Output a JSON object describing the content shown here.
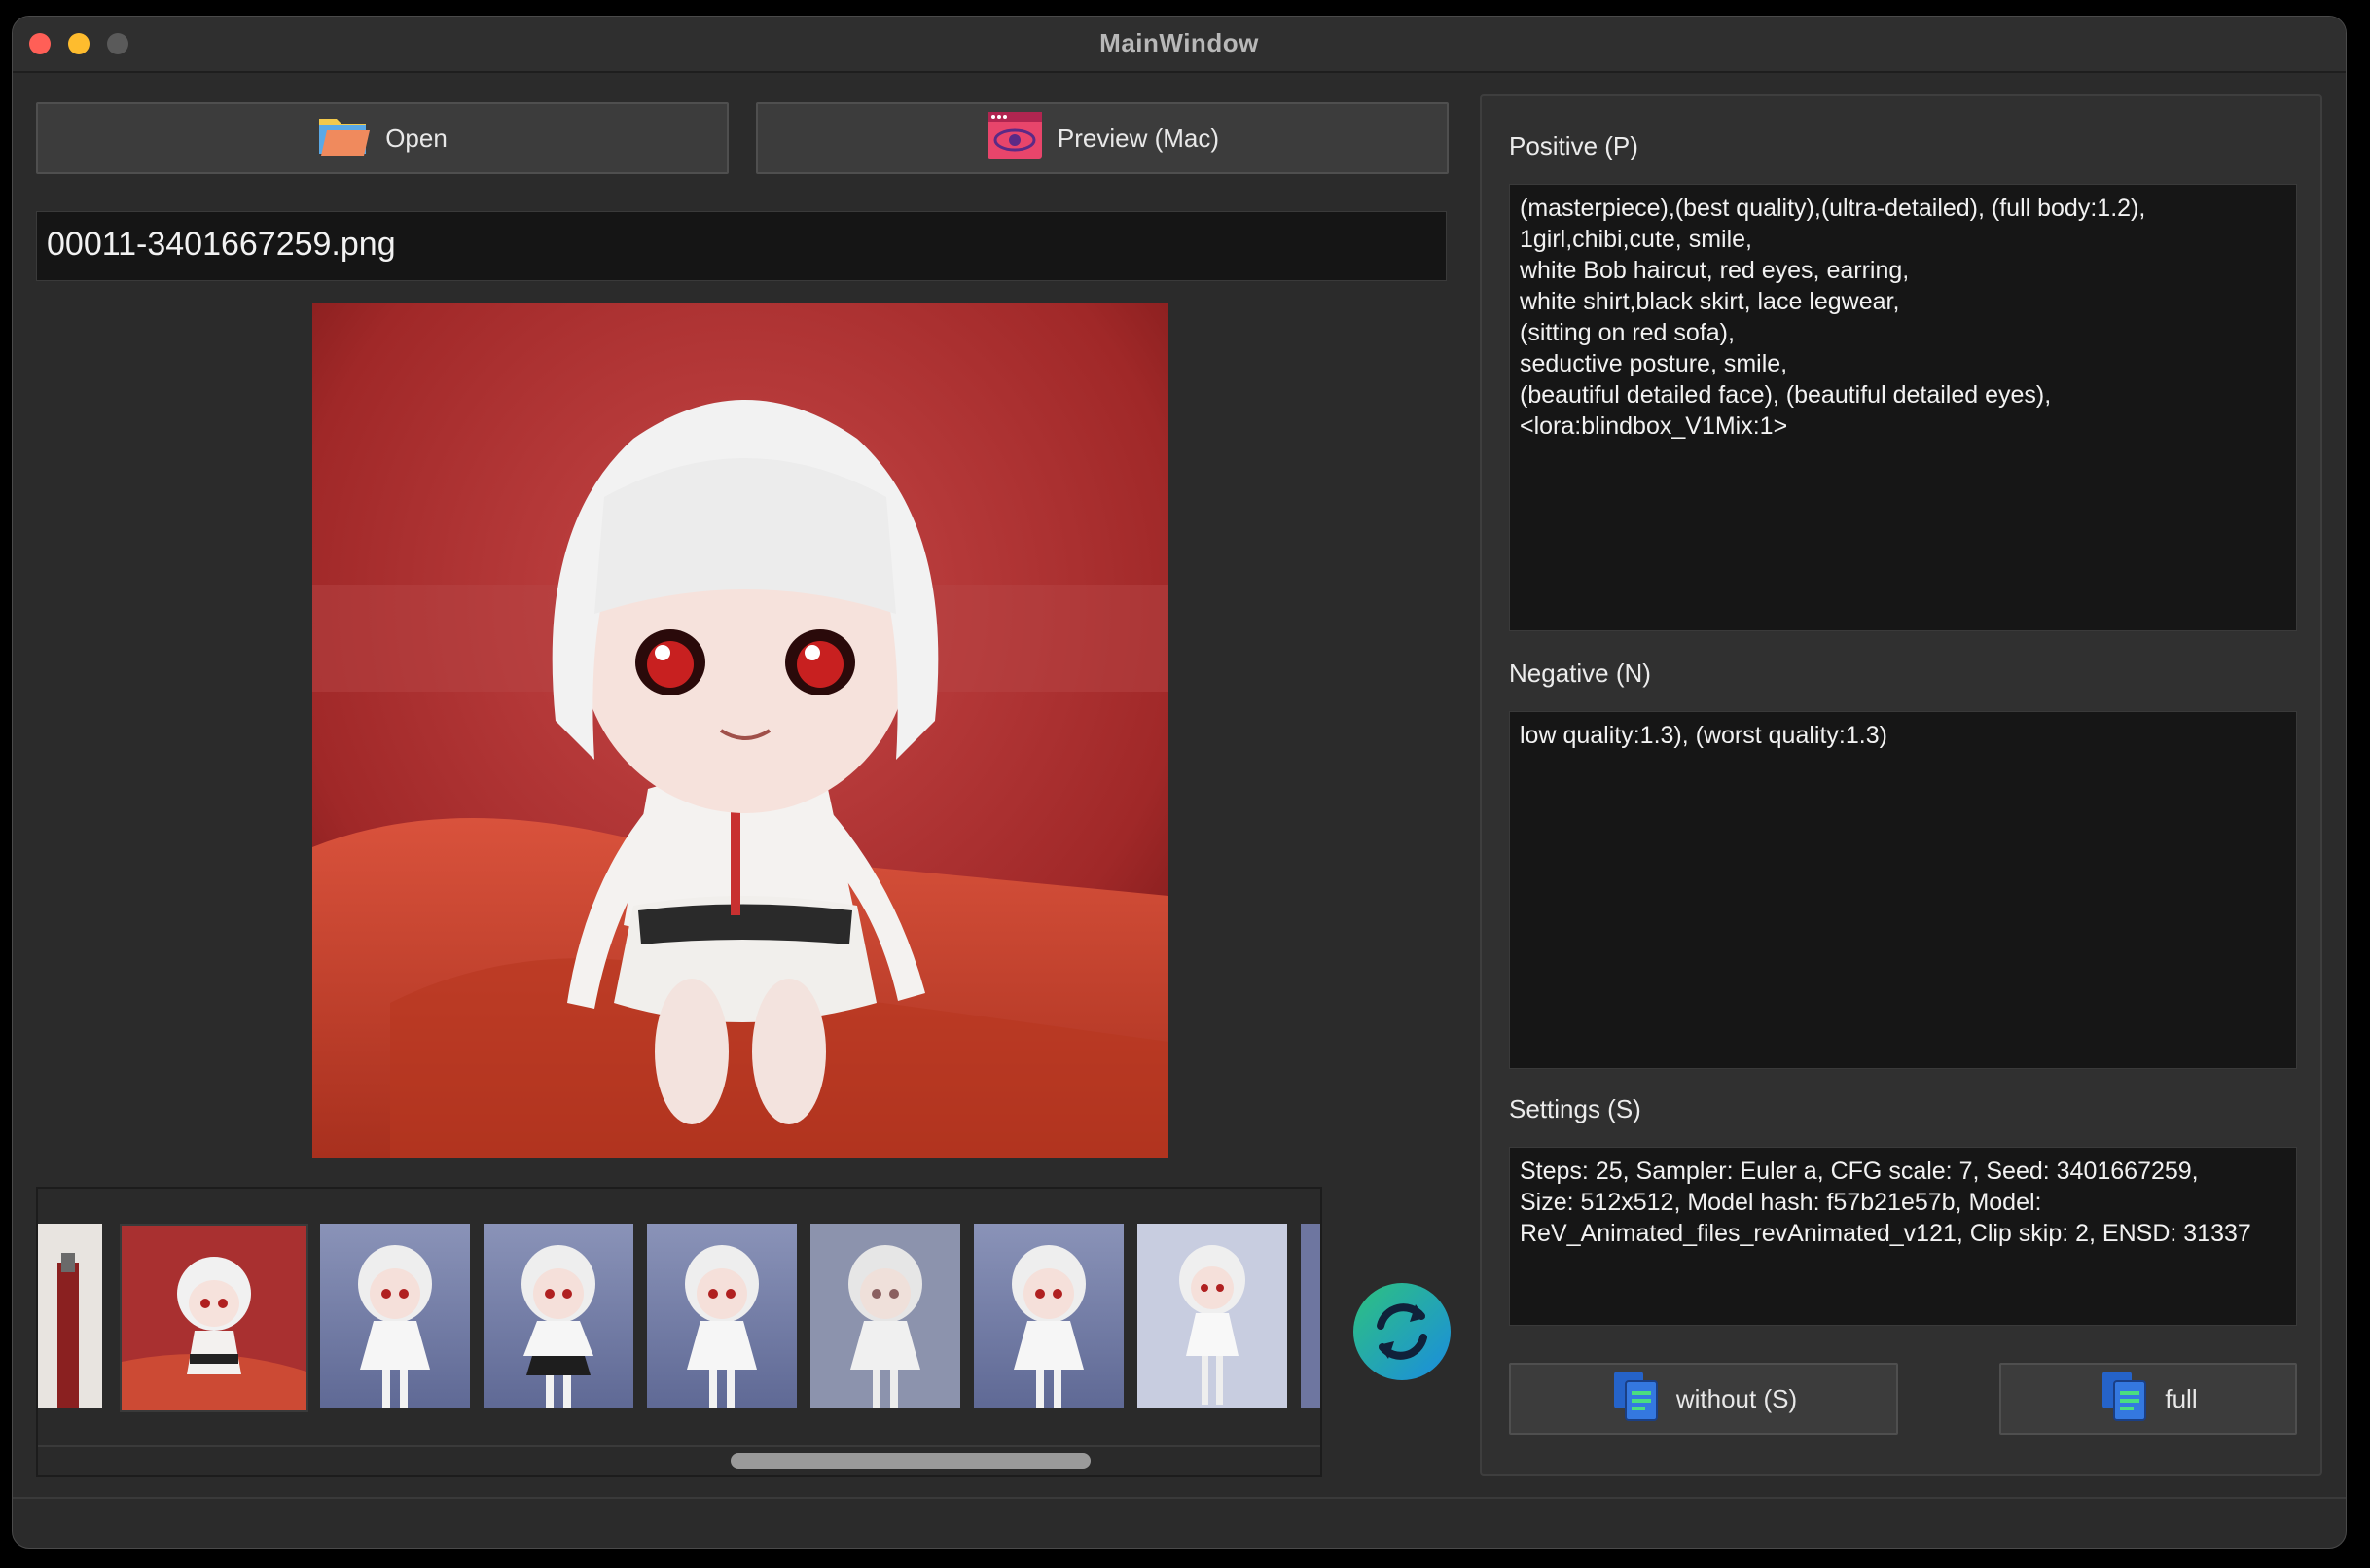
{
  "window": {
    "title": "MainWindow"
  },
  "toolbar": {
    "open_label": "Open",
    "preview_label": "Preview (Mac)",
    "open_icon": "folder-icon",
    "preview_icon": "preview-eye-icon"
  },
  "file": {
    "name": "00011-3401667259.png"
  },
  "thumbnails": {
    "count": 8
  },
  "prompts": {
    "positive_label": "Positive (P)",
    "positive_text": "(masterpiece),(best quality),(ultra-detailed), (full body:1.2),\n1girl,chibi,cute, smile,\nwhite Bob haircut, red eyes, earring,\nwhite shirt,black skirt, lace legwear,\n(sitting on red sofa),\nseductive posture, smile,\n(beautiful detailed face), (beautiful detailed eyes),\n<lora:blindbox_V1Mix:1>",
    "negative_label": "Negative (N)",
    "negative_text": "low quality:1.3), (worst quality:1.3)",
    "settings_label": "Settings (S)",
    "settings_text": "Steps: 25, Sampler: Euler a, CFG scale: 7, Seed: 3401667259,\nSize: 512x512, Model hash: f57b21e57b, Model:\nReV_Animated_files_revAnimated_v121, Clip skip: 2, ENSD: 31337"
  },
  "actions": {
    "without_label": "without (S)",
    "full_label": "full",
    "copy_icon": "copy-document-icon",
    "refresh_icon": "refresh-icon"
  },
  "colors": {
    "background": "#2b2b2b",
    "textbox": "#161616",
    "accent_refresh": "#1aa3c8"
  }
}
